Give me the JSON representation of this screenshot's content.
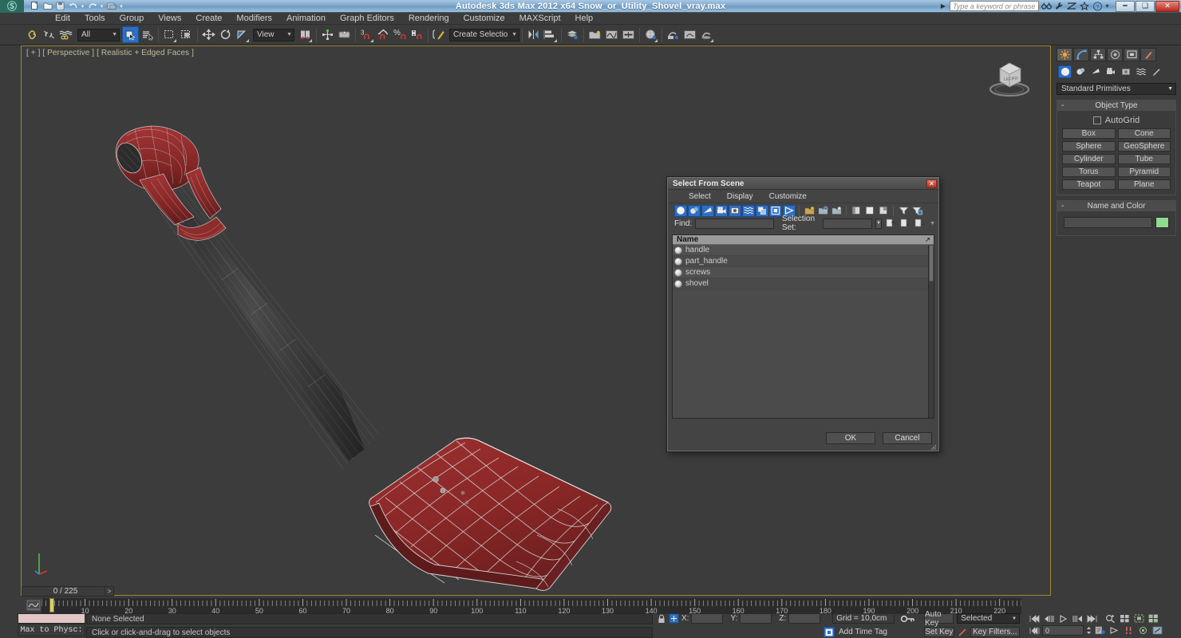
{
  "titlebar": {
    "app_title": "Autodesk 3ds Max  2012 x64     Snow_or_Utility_Shovel_vray.max",
    "logo_glyph": "Ⓜ",
    "quick_access": [
      {
        "name": "new-file-icon",
        "glyph": "⬜"
      },
      {
        "name": "open-file-icon",
        "glyph": "⬜"
      },
      {
        "name": "save-file-icon",
        "glyph": "⬜"
      },
      {
        "name": "undo-icon",
        "glyph": "↶"
      },
      {
        "name": "undo-dropdown-icon",
        "glyph": "▾"
      },
      {
        "name": "redo-icon",
        "glyph": "↷"
      },
      {
        "name": "redo-dropdown-icon",
        "glyph": "▾"
      },
      {
        "name": "set-project-folder-icon",
        "glyph": "⬜"
      },
      {
        "name": "qat-customize-icon",
        "glyph": "▾"
      }
    ],
    "search_placeholder": "Type a keyword or phrase",
    "help_icons": [
      {
        "name": "search-binoculars-icon",
        "glyph": "☌"
      },
      {
        "name": "wrench-icon",
        "glyph": "⚒"
      },
      {
        "name": "exchange-icon",
        "glyph": "⧉"
      },
      {
        "name": "favorites-star-icon",
        "glyph": "☆"
      },
      {
        "name": "help-question-icon",
        "glyph": "?"
      },
      {
        "name": "help-dropdown-icon",
        "glyph": "·"
      }
    ],
    "window_buttons": [
      {
        "name": "minimize-button",
        "glyph": "─"
      },
      {
        "name": "restore-button",
        "glyph": "❐"
      },
      {
        "name": "close-button",
        "glyph": "✕"
      }
    ]
  },
  "menubar": {
    "items": [
      {
        "label": "Edit"
      },
      {
        "label": "Tools"
      },
      {
        "label": "Group"
      },
      {
        "label": "Views"
      },
      {
        "label": "Create"
      },
      {
        "label": "Modifiers"
      },
      {
        "label": "Animation"
      },
      {
        "label": "Graph Editors"
      },
      {
        "label": "Rendering"
      },
      {
        "label": "Customize"
      },
      {
        "label": "MAXScript"
      },
      {
        "label": "Help"
      }
    ]
  },
  "toolbar": {
    "selection_filter": "All",
    "reference_coord_system": "View",
    "named_selection_set": "Create Selection Se",
    "snap_percent_label": "%",
    "snap_count_label": "3"
  },
  "viewport": {
    "label": "[ + ] [ Perspective ] [ Realistic + Edged Faces ]",
    "model_name": "snow-shovel-wireframe",
    "model_color": "#8c2b2b",
    "wire_color": "#c8c8c8",
    "background": "#3c3c3c"
  },
  "command_panel": {
    "tabs": [
      {
        "name": "create-tab",
        "glyph": "☀",
        "active": true
      },
      {
        "name": "modify-tab",
        "glyph": "◜",
        "active": false
      },
      {
        "name": "hierarchy-tab",
        "glyph": "⑂",
        "active": false
      },
      {
        "name": "motion-tab",
        "glyph": "◎",
        "active": false
      },
      {
        "name": "display-tab",
        "glyph": "▣",
        "active": false
      },
      {
        "name": "utilities-tab",
        "glyph": "⚒",
        "active": false
      }
    ],
    "object_category_buttons": [
      {
        "name": "geometry-button",
        "glyph": "●",
        "active": true
      },
      {
        "name": "shapes-button",
        "glyph": "◔",
        "active": false
      },
      {
        "name": "lights-button",
        "glyph": "◢",
        "active": false
      },
      {
        "name": "cameras-button",
        "glyph": "⌧",
        "active": false
      },
      {
        "name": "helpers-button",
        "glyph": "⊞",
        "active": false
      },
      {
        "name": "space-warps-button",
        "glyph": "≈",
        "active": false
      },
      {
        "name": "systems-button",
        "glyph": "✄",
        "active": false
      }
    ],
    "primitives_dropdown": "Standard Primitives",
    "rollouts": [
      {
        "title": "Object Type",
        "minimize_glyph": "-",
        "autogrid_label": "AutoGrid",
        "buttons": [
          "Box",
          "Cone",
          "Sphere",
          "GeoSphere",
          "Cylinder",
          "Tube",
          "Torus",
          "Pyramid",
          "Teapot",
          "Plane"
        ]
      },
      {
        "title": "Name and Color",
        "minimize_glyph": "-",
        "name_value": "",
        "color_swatch": "#8fdb8f"
      }
    ]
  },
  "dialog": {
    "title": "Select From Scene",
    "close_glyph": "✕",
    "menus": [
      {
        "label": "Select"
      },
      {
        "label": "Display"
      },
      {
        "label": "Customize"
      }
    ],
    "toolbar_buttons": [
      {
        "name": "display-geometry-toggle",
        "glyph": "●",
        "active": true
      },
      {
        "name": "display-shapes-toggle",
        "glyph": "◔",
        "active": true
      },
      {
        "name": "display-lights-toggle",
        "glyph": "◢",
        "active": true
      },
      {
        "name": "display-cameras-toggle",
        "glyph": "⌧",
        "active": true
      },
      {
        "name": "display-helpers-toggle",
        "glyph": "⊞",
        "active": true
      },
      {
        "name": "display-space-warps-toggle",
        "glyph": "≈",
        "active": true
      },
      {
        "name": "display-groups-toggle",
        "glyph": "◱",
        "active": true
      },
      {
        "name": "display-xrefs-toggle",
        "glyph": "▣",
        "active": true
      },
      {
        "name": "display-bones-toggle",
        "glyph": "➤",
        "active": true
      },
      {
        "name": "display-containers-icon",
        "glyph": "⬚",
        "active": false
      },
      {
        "name": "display-frozen-icon",
        "glyph": "❄",
        "active": false
      },
      {
        "name": "display-hidden-icon",
        "glyph": "◑",
        "active": false
      },
      {
        "name": "expand-all-icon",
        "glyph": "◧",
        "active": false
      },
      {
        "name": "collapse-all-icon",
        "glyph": "□",
        "active": false
      },
      {
        "name": "expand-selected-icon",
        "glyph": "◫",
        "active": false
      },
      {
        "name": "filter-icon",
        "glyph": "▽",
        "active": false
      },
      {
        "name": "filter-clear-icon",
        "glyph": "▼",
        "active": false
      }
    ],
    "find_label": "Find:",
    "find_value": "",
    "selection_set_label": "Selection Set:",
    "selection_set_value": "",
    "selection_set_buttons": [
      {
        "name": "select-by-set-icon",
        "glyph": "⬚"
      },
      {
        "name": "add-selection-set-icon",
        "glyph": "⬚"
      },
      {
        "name": "remove-selection-set-icon",
        "glyph": "⬚"
      }
    ],
    "list": {
      "column_header": "Name",
      "sort_glyph": "↗",
      "items": [
        {
          "name": "handle"
        },
        {
          "name": "part_handle"
        },
        {
          "name": "screws"
        },
        {
          "name": "shovel"
        }
      ]
    },
    "ok_label": "OK",
    "cancel_label": "Cancel"
  },
  "timeline": {
    "frame_counter": "0 / 225",
    "prev_glyph": "<",
    "next_glyph": ">",
    "ticks": [
      10,
      20,
      30,
      40,
      50,
      60,
      70,
      80,
      90,
      100,
      110,
      120,
      130,
      140,
      150,
      160,
      170,
      180,
      190,
      200,
      210,
      220
    ],
    "range_start": 0,
    "range_end": 225
  },
  "status": {
    "max_to_physx": "Max to Physc:",
    "selection_status": "None Selected",
    "prompt": "Click or click-and-drag to select objects",
    "lock_icon": "⚿",
    "absolute_mode_icon": "⬚",
    "x_label": "X:",
    "y_label": "Y:",
    "z_label": "Z:",
    "x_value": "",
    "y_value": "",
    "z_value": "",
    "grid_label": "Grid = 10,0cm",
    "add_time_tag": "Add Time Tag",
    "key_mode_icon": "⚷"
  },
  "animation": {
    "auto_key": "Auto Key",
    "set_key": "Set Key",
    "selected_filter": "Selected",
    "key_filters": "Key Filters...",
    "spinner_value": "0",
    "playback_buttons": [
      {
        "name": "goto-start-button",
        "glyph": "⏮"
      },
      {
        "name": "prev-frame-button",
        "glyph": "⏪"
      },
      {
        "name": "play-button",
        "glyph": "▷"
      },
      {
        "name": "next-frame-button",
        "glyph": "⏩"
      },
      {
        "name": "goto-end-button",
        "glyph": "⏭"
      }
    ],
    "nav_buttons_row1": [
      {
        "name": "zoom-icon",
        "glyph": "⌕"
      },
      {
        "name": "zoom-all-icon",
        "glyph": "⊞"
      },
      {
        "name": "zoom-extents-icon",
        "glyph": "⬚"
      },
      {
        "name": "zoom-extents-all-icon",
        "glyph": "⬚"
      }
    ],
    "nav_buttons_row2": [
      {
        "name": "key-mode-toggle-icon",
        "glyph": "⏭"
      },
      {
        "name": "time-config-icon",
        "glyph": "⬚"
      },
      {
        "name": "pan-icon",
        "glyph": "✋"
      },
      {
        "name": "field-of-view-icon",
        "glyph": "↕"
      },
      {
        "name": "orbit-icon",
        "glyph": "⟳"
      },
      {
        "name": "maximize-viewport-icon",
        "glyph": "⬚"
      }
    ]
  }
}
